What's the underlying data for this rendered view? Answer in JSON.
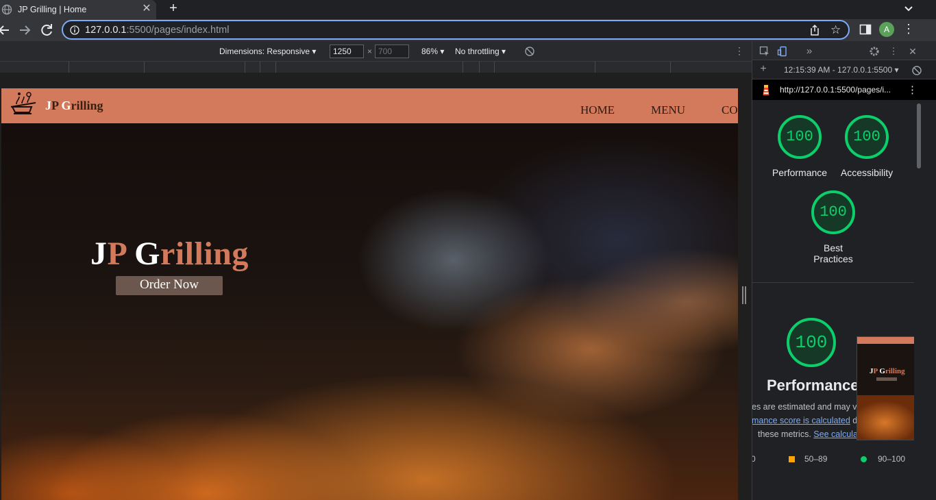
{
  "browser": {
    "tab_title": "JP Grilling | Home",
    "url_host": "127.0.0.1",
    "url_rest": ":5500/pages/index.html",
    "avatar_letter": "A"
  },
  "device_toolbar": {
    "dimensions_label": "Dimensions: Responsive ▾",
    "width_value": "1250",
    "height_placeholder": "700",
    "times": "×",
    "zoom": "86% ▾",
    "throttling": "No throttling ▾"
  },
  "site": {
    "logo_j": "J",
    "logo_p": "P ",
    "logo_g": "G",
    "logo_rest": "rilling",
    "nav": [
      "HOME",
      "MENU",
      "CO"
    ],
    "hero_j": "J",
    "hero_p": "P ",
    "hero_g": "G",
    "hero_rest": "rilling",
    "order_button": "Order Now"
  },
  "devtools": {
    "timestamp": "12:15:39 AM - 127.0.0.1:5500 ▾",
    "report_url": "http://127.0.0.1:5500/pages/i...",
    "scores": [
      {
        "label": "Performance",
        "value": "100"
      },
      {
        "label": "Accessibility",
        "value": "100"
      },
      {
        "label_line1": "Best",
        "label_line2": "Practices",
        "value": "100"
      }
    ],
    "perf_score": "100",
    "perf_heading": "Performance",
    "desc_line1": "es are estimated and may va",
    "desc_link1": "mance score is calculated",
    "desc_tail1": " di",
    "desc_line3_pre": "these metrics. ",
    "desc_link2": "See calculat",
    "thumb_title_j": "J",
    "thumb_title_p": "P ",
    "thumb_title_g": "G",
    "thumb_title_rest": "rilling",
    "legend": [
      {
        "range": "0",
        "color": "#ff4e42"
      },
      {
        "range": "50–89",
        "color": "#ffa400"
      },
      {
        "range": "90–100",
        "color": "#0cce6b"
      }
    ]
  },
  "colors": {
    "brand": "#d27a5b",
    "score_green": "#0cce6b",
    "accent_blue": "#7cacf8"
  }
}
